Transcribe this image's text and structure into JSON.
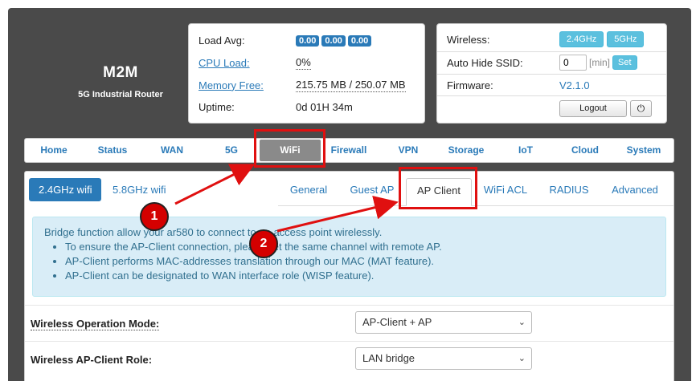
{
  "brand": {
    "name": "M2M",
    "subtitle": "5G Industrial Router"
  },
  "status": {
    "load_avg_label": "Load Avg:",
    "load_avg": [
      "0.00",
      "0.00",
      "0.00"
    ],
    "cpu_label": "CPU Load:",
    "cpu_value": "0%",
    "mem_label": "Memory Free:",
    "mem_value": "215.75 MB / 250.07 MB",
    "uptime_label": "Uptime:",
    "uptime_value": "0d 01H 34m"
  },
  "wireless_panel": {
    "wireless_label": "Wireless:",
    "band_24": "2.4GHz",
    "band_5": "5GHz",
    "ssid_label": "Auto Hide SSID:",
    "ssid_value": "0",
    "ssid_unit": "[min]",
    "set_label": "Set",
    "fw_label": "Firmware:",
    "fw_value": "V2.1.0",
    "logout_label": "Logout",
    "power_glyph": "⏻"
  },
  "nav": {
    "items": [
      "Home",
      "Status",
      "WAN",
      "5G",
      "WiFi",
      "Firewall",
      "VPN",
      "Storage",
      "IoT",
      "Cloud",
      "System"
    ],
    "active": "WiFi"
  },
  "band_tabs": {
    "active": "2.4GHz wifi",
    "other": "5.8GHz wifi"
  },
  "sub_tabs": {
    "items": [
      "General",
      "Guest AP",
      "AP Client",
      "WiFi ACL",
      "RADIUS",
      "Advanced"
    ],
    "active": "AP Client"
  },
  "info": {
    "head": "Bridge function allow your ar580 to connect to an access point wirelessly.",
    "bullets": [
      "To ensure the AP-Client connection, please set the same channel with remote AP.",
      "AP-Client performs MAC-addresses translation through our MAC (MAT feature).",
      "AP-Client can be designated to WAN interface role (WISP feature)."
    ]
  },
  "form": {
    "mode_label": "Wireless Operation Mode:",
    "mode_value": "AP-Client + AP",
    "role_label": "Wireless AP-Client Role:",
    "role_value": "LAN bridge",
    "chevron": "⌄"
  },
  "annotations": {
    "marker1": "1",
    "marker2": "2",
    "color": "#e01010"
  },
  "colors": {
    "accent": "#2a7ab8",
    "info_bg": "#d9edf7",
    "info_text": "#31708f",
    "frame": "#4a4a4a"
  }
}
